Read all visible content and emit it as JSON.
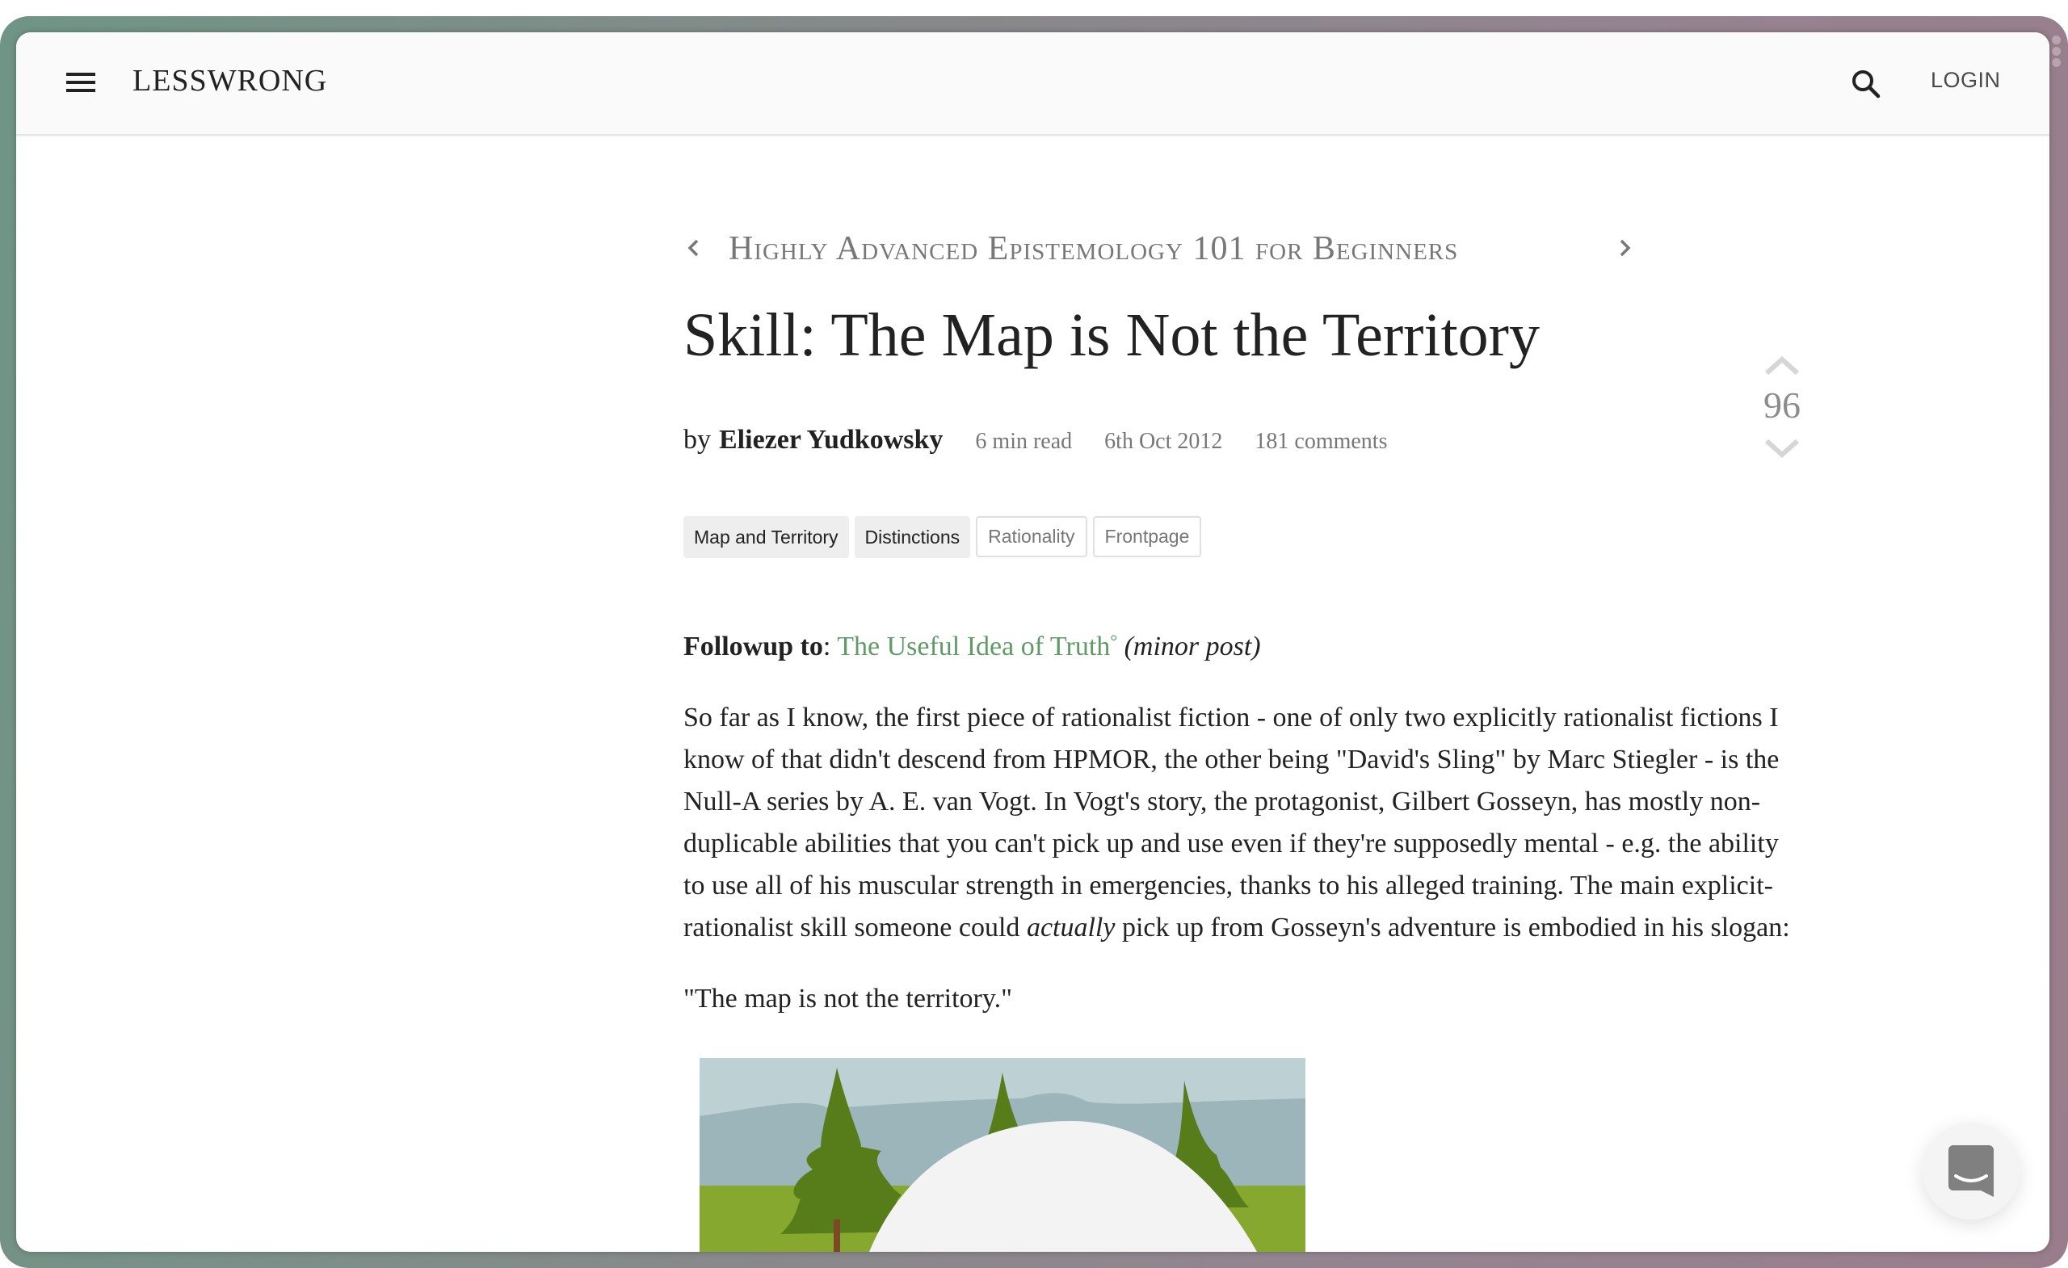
{
  "header": {
    "logo": "LESSWRONG",
    "login_label": "LOGIN",
    "menu_icon": "hamburger-menu-icon",
    "search_icon": "search-icon"
  },
  "sequence": {
    "title": "Highly Advanced Epistemology 101 for Beginners",
    "prev_icon": "chevron-left-icon",
    "next_icon": "chevron-right-icon"
  },
  "post": {
    "title": "Skill: The Map is Not the Territory",
    "by": "by",
    "author": "Eliezer Yudkowsky",
    "read_time": "6 min read",
    "date": "6th Oct 2012",
    "comments": "181 comments",
    "score": "96",
    "tags": [
      {
        "label": "Map and Territory",
        "style": "core"
      },
      {
        "label": "Distinctions",
        "style": "core"
      },
      {
        "label": "Rationality",
        "style": "plain"
      },
      {
        "label": "Frontpage",
        "style": "plain"
      }
    ]
  },
  "body": {
    "followup_label": "Followup to",
    "followup_colon": ": ",
    "followup_link": "The Useful Idea of Truth",
    "followup_link_mark": "°",
    "followup_note": "(minor post)",
    "paragraph1_a": "So far as I know, the first piece of rationalist fiction - one of only two explicitly rationalist fictions I know of that didn't descend from HPMOR, the other being \"David's Sling\" by Marc Stiegler - is the Null-A series by A. E. van Vogt. In Vogt's story, the protagonist, Gilbert Gosseyn, has mostly non-duplicable abilities that you can't pick up and use even if they're supposedly mental - e.g. the ability to use all of his muscular strength in emergencies, thanks to his alleged training. The main explicit-rationalist skill someone could ",
    "paragraph1_em": "actually",
    "paragraph1_b": " pick up from Gosseyn's adventure is embodied in his slogan:",
    "quote": "\"The map is not the territory.\""
  },
  "figure": {
    "description": "illustration of pine trees, mountains and a white dome"
  },
  "colors": {
    "link": "#5f9b65",
    "text": "#222222",
    "muted": "#777777"
  }
}
